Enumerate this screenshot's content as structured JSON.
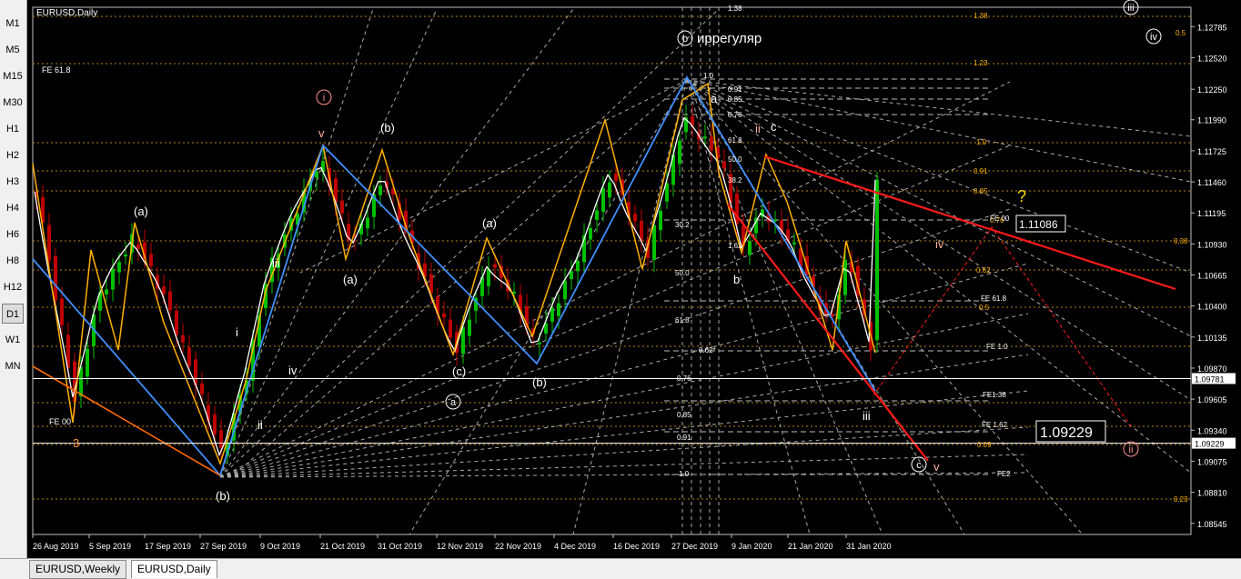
{
  "timeframes": [
    "M1",
    "M5",
    "M15",
    "M30",
    "H1",
    "H2",
    "H3",
    "H4",
    "H6",
    "H8",
    "H12",
    "D1",
    "W1",
    "MN"
  ],
  "active_timeframe": "D1",
  "tabs": [
    "EURUSD,Weekly",
    "EURUSD,Daily"
  ],
  "active_tab": "EURUSD,Daily",
  "chart_data": {
    "type": "candlestick",
    "title": "EURUSD,Daily",
    "ylim": [
      1.0845,
      1.1295
    ],
    "y_ticks": [
      "1.12785",
      "1.12520",
      "1.12250",
      "1.11990",
      "1.11725",
      "1.11460",
      "1.11195",
      "1.10930",
      "1.10665",
      "1.10400",
      "1.10135",
      "1.09870",
      "1.09605",
      "1.09340",
      "1.09075",
      "1.08810",
      "1.08545"
    ],
    "x_ticks": [
      "26 Aug 2019",
      "5 Sep 2019",
      "17 Sep 2019",
      "27 Sep 2019",
      "9 Oct 2019",
      "21 Oct 2019",
      "31 Oct 2019",
      "12 Nov 2019",
      "22 Nov 2019",
      "4 Dec 2019",
      "16 Dec 2019",
      "27 Dec 2019",
      "9 Jan 2020",
      "21 Jan 2020",
      "31 Jan 2020"
    ],
    "current_price": "1.09781",
    "horizontal_line_price": "1.09229",
    "price_boxes": [
      "1.11086",
      "1.09229"
    ],
    "annotations": {
      "title_note": "иррегуляр",
      "question": "?",
      "fe_top_left": "FE 61.8",
      "fe_bottom_left": "FE 00",
      "wave_labels": [
        "3",
        "(a)",
        "(b)",
        "i",
        "ii",
        "iii",
        "iv",
        "v",
        "(b)",
        "(a)",
        "(c)",
        "(a)",
        "(b)",
        "a",
        "b",
        "c",
        "ii",
        "iii",
        "iv",
        "v",
        "(a)",
        "(b)",
        "(c)"
      ],
      "circled_labels": [
        "i",
        "ii",
        "iii",
        "iv",
        "b",
        "c",
        "a"
      ],
      "fib_labels_right": [
        "1.38",
        "1.23",
        "1.0",
        "0.91",
        "0.85",
        "0.76",
        "0.62",
        "0.5",
        "0.38",
        "0.23",
        "0.09",
        "0.5"
      ],
      "fe_labels_right": [
        "FE 00",
        "FE 61.8",
        "FE 1.0",
        "FE1.38",
        "FE 1.62",
        "FE2"
      ],
      "fib_labels_mid": [
        "1.38",
        "1.0",
        "0.91",
        "0.85",
        "0.76",
        "61.8",
        "50.0",
        "38.2",
        "30.2",
        "1.62",
        "50.0",
        "61.8",
        "0.62*",
        "0.76",
        "0.85",
        "0.91",
        "1.0"
      ]
    }
  }
}
